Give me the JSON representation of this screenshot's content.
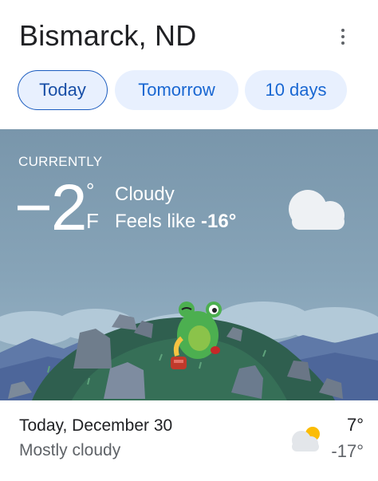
{
  "header": {
    "location": "Bismarck, ND",
    "more_icon": "more-vert-icon"
  },
  "tabs": [
    {
      "label": "Today",
      "selected": true
    },
    {
      "label": "Tomorrow",
      "selected": false
    },
    {
      "label": "10 days",
      "selected": false
    }
  ],
  "current": {
    "heading": "CURRENTLY",
    "temperature": "−2",
    "degree_symbol": "°",
    "unit": "F",
    "condition": "Cloudy",
    "feels_like_prefix": "Feels like ",
    "feels_like_value": "-16°",
    "icon": "cloud-icon"
  },
  "forecast": {
    "day": "Today, December 30",
    "condition": "Mostly cloudy",
    "high": "7°",
    "low": "-17°",
    "icon": "partly-cloudy-icon"
  },
  "colors": {
    "accent": "#1967d2",
    "tab_background": "#e8f0fe",
    "sky": "#7996ab",
    "hill": "#2f5f4f",
    "frog": "#4caf50"
  }
}
